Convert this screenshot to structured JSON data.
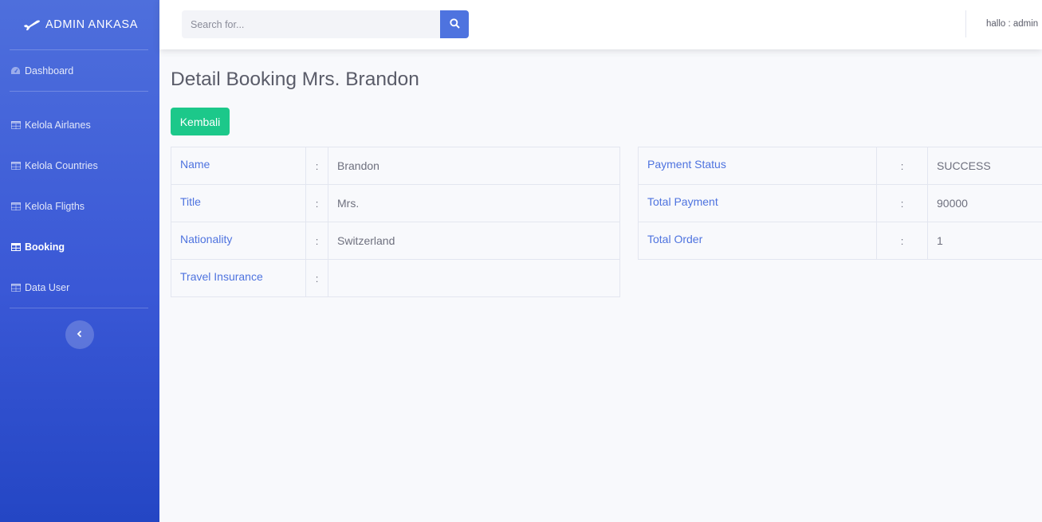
{
  "sidebar": {
    "brand": "ADMIN ANKASA",
    "items": [
      {
        "label": "Dashboard",
        "icon": "tachometer-icon"
      },
      {
        "label": "Kelola Airlanes",
        "icon": "table-icon"
      },
      {
        "label": "Kelola Countries",
        "icon": "table-icon"
      },
      {
        "label": "Kelola Fligths",
        "icon": "table-icon"
      },
      {
        "label": "Booking",
        "icon": "table-icon",
        "active": true
      },
      {
        "label": "Data User",
        "icon": "table-icon"
      }
    ]
  },
  "topbar": {
    "search_placeholder": "Search for...",
    "user_text": "hallo : admin"
  },
  "main": {
    "title": "Detail Booking Mrs. Brandon",
    "back_label": "Kembali",
    "separator": ":",
    "left_rows": [
      {
        "label": "Name",
        "value": "Brandon"
      },
      {
        "label": "Title",
        "value": "Mrs."
      },
      {
        "label": "Nationality",
        "value": "Switzerland"
      },
      {
        "label": "Travel Insurance",
        "value": ""
      }
    ],
    "right_rows": [
      {
        "label": "Payment Status",
        "value": "SUCCESS"
      },
      {
        "label": "Total Payment",
        "value": "90000"
      },
      {
        "label": "Total Order",
        "value": "1"
      }
    ]
  },
  "colors": {
    "sidebar_top": "#4e6fdc",
    "sidebar_bottom": "#2446c4",
    "primary": "#4e73df",
    "success": "#1cc88a",
    "background": "#f8f9fc"
  }
}
